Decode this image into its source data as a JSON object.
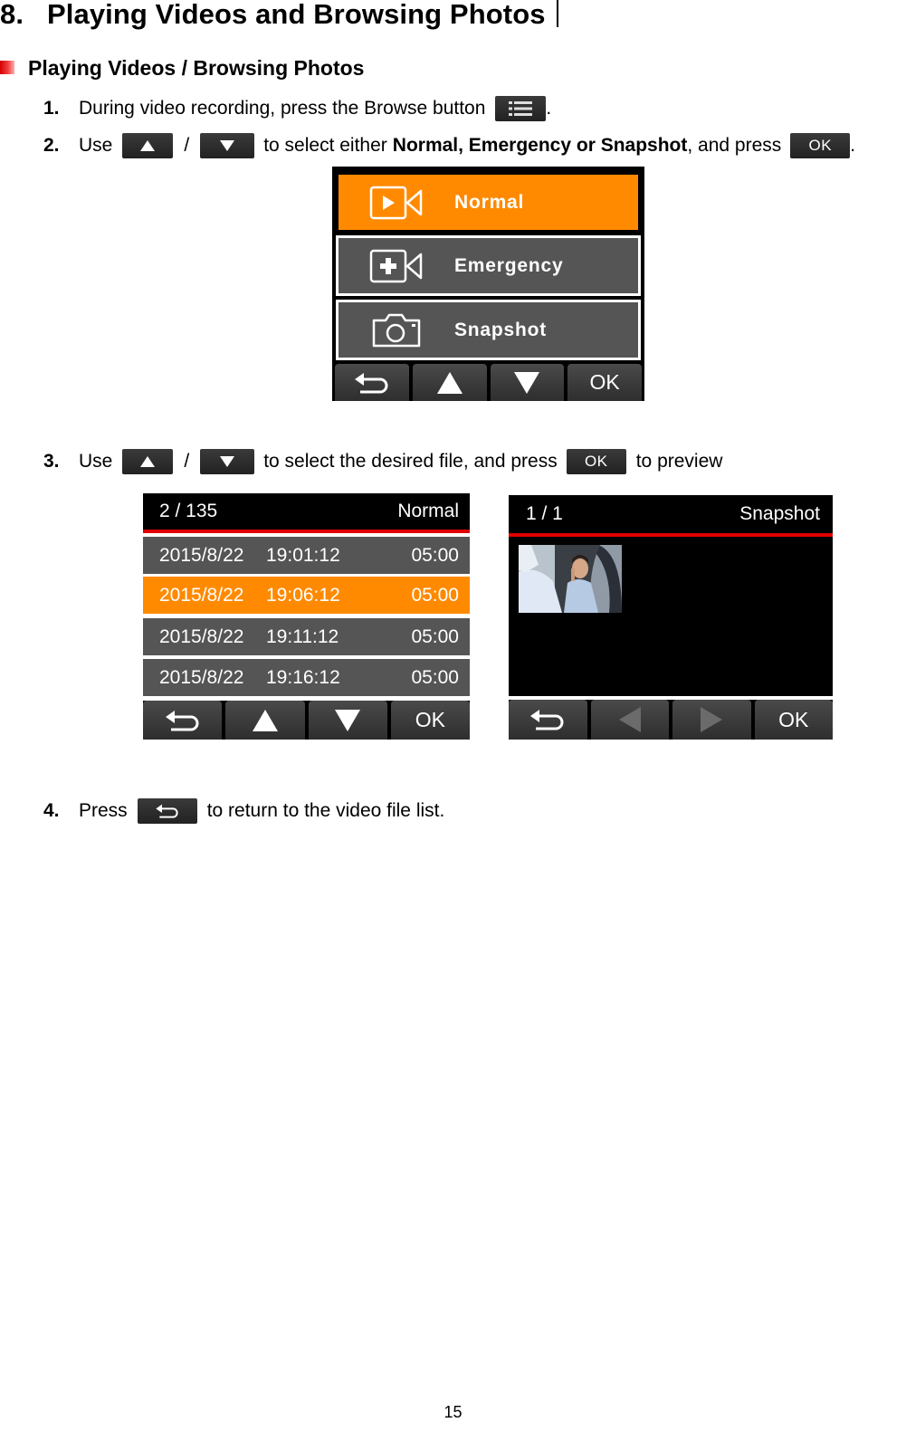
{
  "section": {
    "number": "8.",
    "title": "Playing Videos and Browsing Photos"
  },
  "subsection": {
    "title": "Playing Videos / Browsing Photos",
    "bullet_color": "#e02020"
  },
  "steps": [
    {
      "number": "1.",
      "text_before": "During video recording, press the Browse button",
      "button_icon": "list-icon",
      "text_after": "."
    },
    {
      "number": "2.",
      "text_1": "Use",
      "separator": "/",
      "text_2": "to select either",
      "bold": "Normal, Emergency or Snapshot",
      "text_3": ", and press",
      "ok_label": "OK",
      "text_after": "."
    },
    {
      "number": "3.",
      "text_1": "Use",
      "separator": "/",
      "text_2": "to select the desired file, and press",
      "ok_label": "OK",
      "text_3": "to preview"
    },
    {
      "number": "4.",
      "text_1": "Press",
      "button_icon": "back-icon",
      "text_2": "to return to the video file list."
    }
  ],
  "mode_menu": {
    "items": [
      {
        "label": "Normal",
        "icon": "video-play-icon",
        "selected": true
      },
      {
        "label": "Emergency",
        "icon": "video-emergency-icon",
        "selected": false
      },
      {
        "label": "Snapshot",
        "icon": "camera-icon",
        "selected": false
      }
    ],
    "buttons": [
      "back",
      "up",
      "down",
      "OK"
    ],
    "ok_label": "OK"
  },
  "file_list": {
    "counter": "2 / 135",
    "category": "Normal",
    "rows": [
      {
        "date": "2015/8/22",
        "time": "19:01:12",
        "duration": "05:00",
        "selected": false
      },
      {
        "date": "2015/8/22",
        "time": "19:06:12",
        "duration": "05:00",
        "selected": true
      },
      {
        "date": "2015/8/22",
        "time": "19:11:12",
        "duration": "05:00",
        "selected": false
      },
      {
        "date": "2015/8/22",
        "time": "19:16:12",
        "duration": "05:00",
        "selected": false
      }
    ],
    "ok_label": "OK"
  },
  "snapshot_view": {
    "counter": "1 / 1",
    "category": "Snapshot",
    "thumbnail": "photo of man on phone in car",
    "ok_label": "OK"
  },
  "colors": {
    "highlight": "#ff8a00",
    "row_bg": "#555555",
    "header_rule": "#e00000"
  },
  "page_number": "15"
}
